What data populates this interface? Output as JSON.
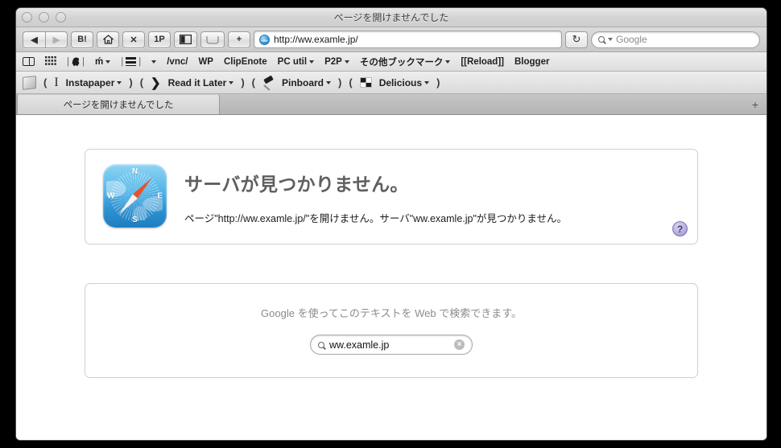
{
  "window": {
    "title": "ページを開けませんでした",
    "traffic_lights": [
      "close",
      "minimize",
      "zoom"
    ]
  },
  "toolbar": {
    "back_label": "◀",
    "forward_label": "▶",
    "hatena_label": "B!",
    "home_label": "home-icon",
    "stop_label": "✕",
    "onepassword_label": "1P",
    "sidebar_label": "sidebar-icon",
    "readinglist_label": "readinglist-icon",
    "add_label": "+",
    "url_value": "http://ww.examle.jp/",
    "reload_label": "↻",
    "search_placeholder": "Google"
  },
  "bookmarks_bar": {
    "items": [
      {
        "label": "",
        "icon": "book-icon",
        "menu": false
      },
      {
        "label": "",
        "icon": "grid-icon",
        "menu": false
      },
      {
        "label": "",
        "icon": "apple-icon",
        "menu": false
      },
      {
        "label": "ḿ",
        "icon": "",
        "menu": true
      },
      {
        "label": "",
        "icon": "hamburger-icon",
        "menu": false
      },
      {
        "label": "",
        "icon": "",
        "menu": true
      },
      {
        "label": "/vnc/",
        "icon": "",
        "menu": false
      },
      {
        "label": "WP",
        "icon": "",
        "menu": false
      },
      {
        "label": "ClipEnote",
        "icon": "",
        "menu": false
      },
      {
        "label": "PC util",
        "icon": "",
        "menu": true
      },
      {
        "label": "P2P",
        "icon": "",
        "menu": true
      },
      {
        "label": "その他ブックマーク",
        "icon": "",
        "menu": true
      },
      {
        "label": "[[Reload]]",
        "icon": "",
        "menu": false
      },
      {
        "label": "Blogger",
        "icon": "",
        "menu": false
      }
    ]
  },
  "extension_bar": {
    "items": [
      {
        "type": "icon",
        "icon": "cube-icon",
        "label": ""
      },
      {
        "type": "paren",
        "label": "("
      },
      {
        "type": "icon",
        "icon": "ibeam-icon",
        "label": "I"
      },
      {
        "type": "menu",
        "label": "Instapaper"
      },
      {
        "type": "paren",
        "label": ")"
      },
      {
        "type": "paren",
        "label": "("
      },
      {
        "type": "icon",
        "icon": "chevron-right-icon",
        "label": "❯"
      },
      {
        "type": "menu",
        "label": "Read it Later"
      },
      {
        "type": "paren",
        "label": ")"
      },
      {
        "type": "paren",
        "label": "("
      },
      {
        "type": "icon",
        "icon": "pin-icon",
        "label": ""
      },
      {
        "type": "menu",
        "label": "Pinboard"
      },
      {
        "type": "paren",
        "label": ")"
      },
      {
        "type": "paren",
        "label": "("
      },
      {
        "type": "icon",
        "icon": "checker-icon",
        "label": ""
      },
      {
        "type": "menu",
        "label": "Delicious"
      },
      {
        "type": "paren",
        "label": ")"
      }
    ]
  },
  "tabbar": {
    "tab_title": "ページを開けませんでした",
    "new_tab_label": "+"
  },
  "error_panel": {
    "heading": "サーバが見つかりません。",
    "description": "ページ\"http://ww.examle.jp/\"を開けません。サーバ\"ww.examle.jp\"が見つかりません。",
    "help_label": "?",
    "icon": "safari-compass-icon",
    "compass_letters": {
      "n": "N",
      "s": "S",
      "w": "W",
      "e": "E"
    }
  },
  "search_panel": {
    "hint": "Google を使ってこのテキストを Web で検索できます。",
    "query_value": "ww.examle.jp",
    "clear_label": "×"
  },
  "colors": {
    "desktop": "#000000",
    "window_chrome": "#d4d4d4",
    "heading_gray": "#5f5f5f",
    "hint_gray": "#8c8c8c",
    "help_purple": "#9a8ece",
    "compass_blue": "#2f93d2",
    "needle_red": "#e8502a"
  }
}
